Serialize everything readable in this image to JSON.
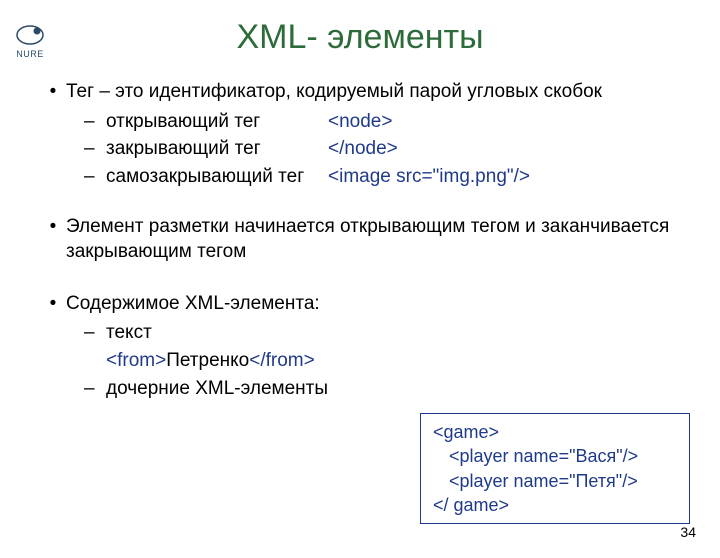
{
  "logo": {
    "text": "NURE"
  },
  "title": "XML- элементы",
  "bullets": {
    "b1": "Тег –  это идентификатор, кодируемый парой угловых скобок",
    "b1_sub": {
      "r1_label": "открывающий тег",
      "r1_value": "<node>",
      "r2_label": "закрывающий тег",
      "r2_value": "</node>",
      "r3_label": "самозакрывающий тег",
      "r3_value": "<image src=\"img.png\"/>"
    },
    "b2": "Элемент разметки начинается открывающим тегом и заканчивается закрывающим тегом",
    "b3": "Содержимое XML-элемента:",
    "b3_sub": {
      "r1_label": "текст",
      "r1_ex_open": "<from>",
      "r1_ex_text": "Петренко",
      "r1_ex_close": "</from>",
      "r2_label": "дочерние XML-элементы"
    }
  },
  "codebox": {
    "l1": "<game>",
    "l2": "<player name=\"Вася\"/>",
    "l3": "<player name=\"Петя\"/>",
    "l4": "</ game>"
  },
  "page": "34"
}
